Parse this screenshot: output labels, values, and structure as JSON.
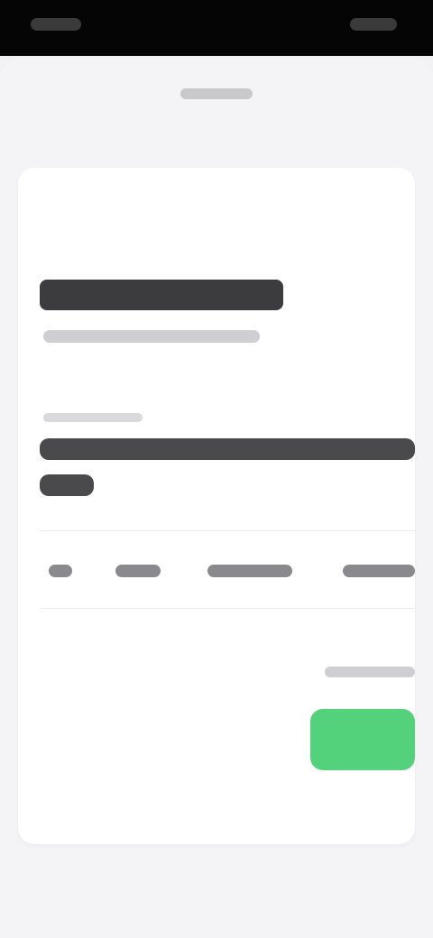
{
  "status_bar": {},
  "nav": {},
  "card": {},
  "colors": {
    "accent": "#53d27b",
    "back": "#7fd6a7",
    "background": "#f2f2f5",
    "card": "#ffffff"
  }
}
